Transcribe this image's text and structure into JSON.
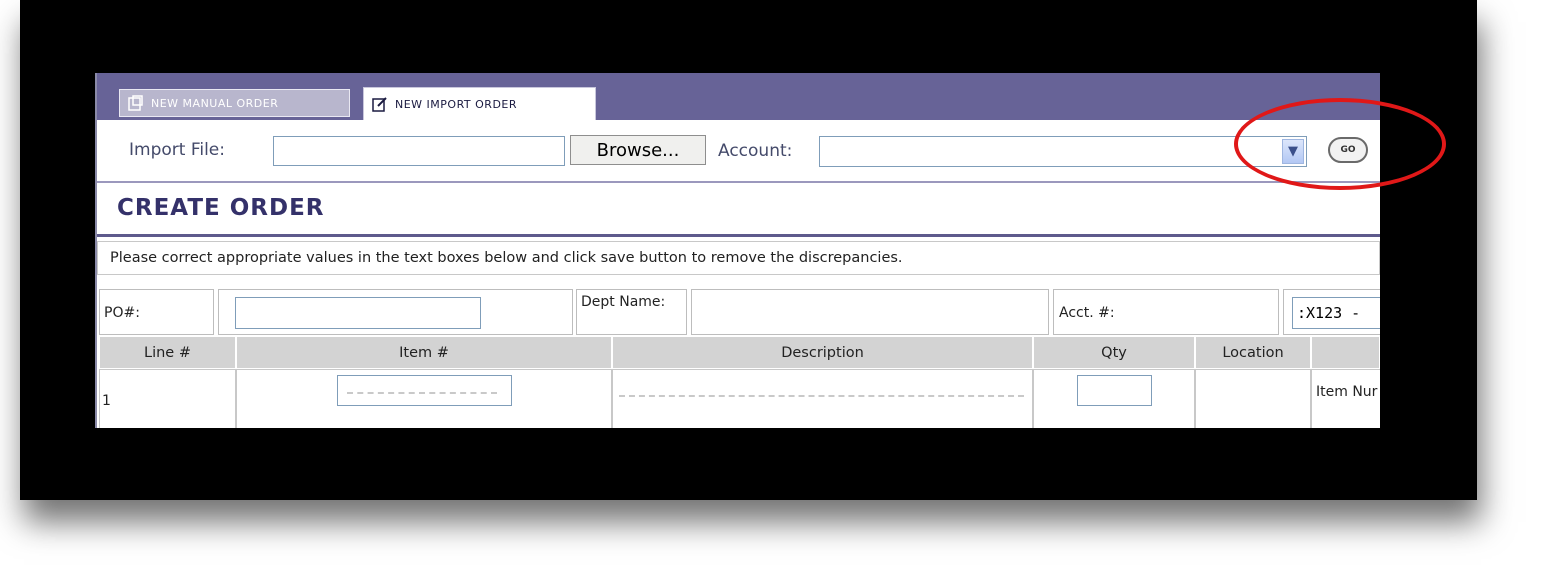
{
  "tabs": [
    {
      "label": "NEW MANUAL ORDER",
      "icon": "order-icon",
      "active": false
    },
    {
      "label": "NEW IMPORT ORDER",
      "icon": "edit-icon",
      "active": true
    }
  ],
  "import": {
    "file_label": "Import File:",
    "file_value": "",
    "browse_label": "Browse...",
    "account_label": "Account:",
    "account_value": "",
    "go_label": "GO"
  },
  "page_title": "CREATE ORDER",
  "notice": "Please correct appropriate values in the text boxes below and click save button to remove the discrepancies.",
  "po_row": {
    "po_label": "PO#:",
    "po_value": "",
    "dept_label": "Dept Name:",
    "dept_value": "",
    "acct_label": "Acct. #:",
    "acct_value": ":X123 -"
  },
  "grid": {
    "columns": [
      "Line #",
      "Item #",
      "Description",
      "Qty",
      "Location",
      ""
    ],
    "rows": [
      {
        "line": "1",
        "item": "",
        "description": "",
        "qty": "",
        "location": "",
        "extra": "Item Nur"
      }
    ]
  },
  "colors": {
    "tabbar": "#676397",
    "title": "#34316a",
    "highlight": "#e01818"
  }
}
